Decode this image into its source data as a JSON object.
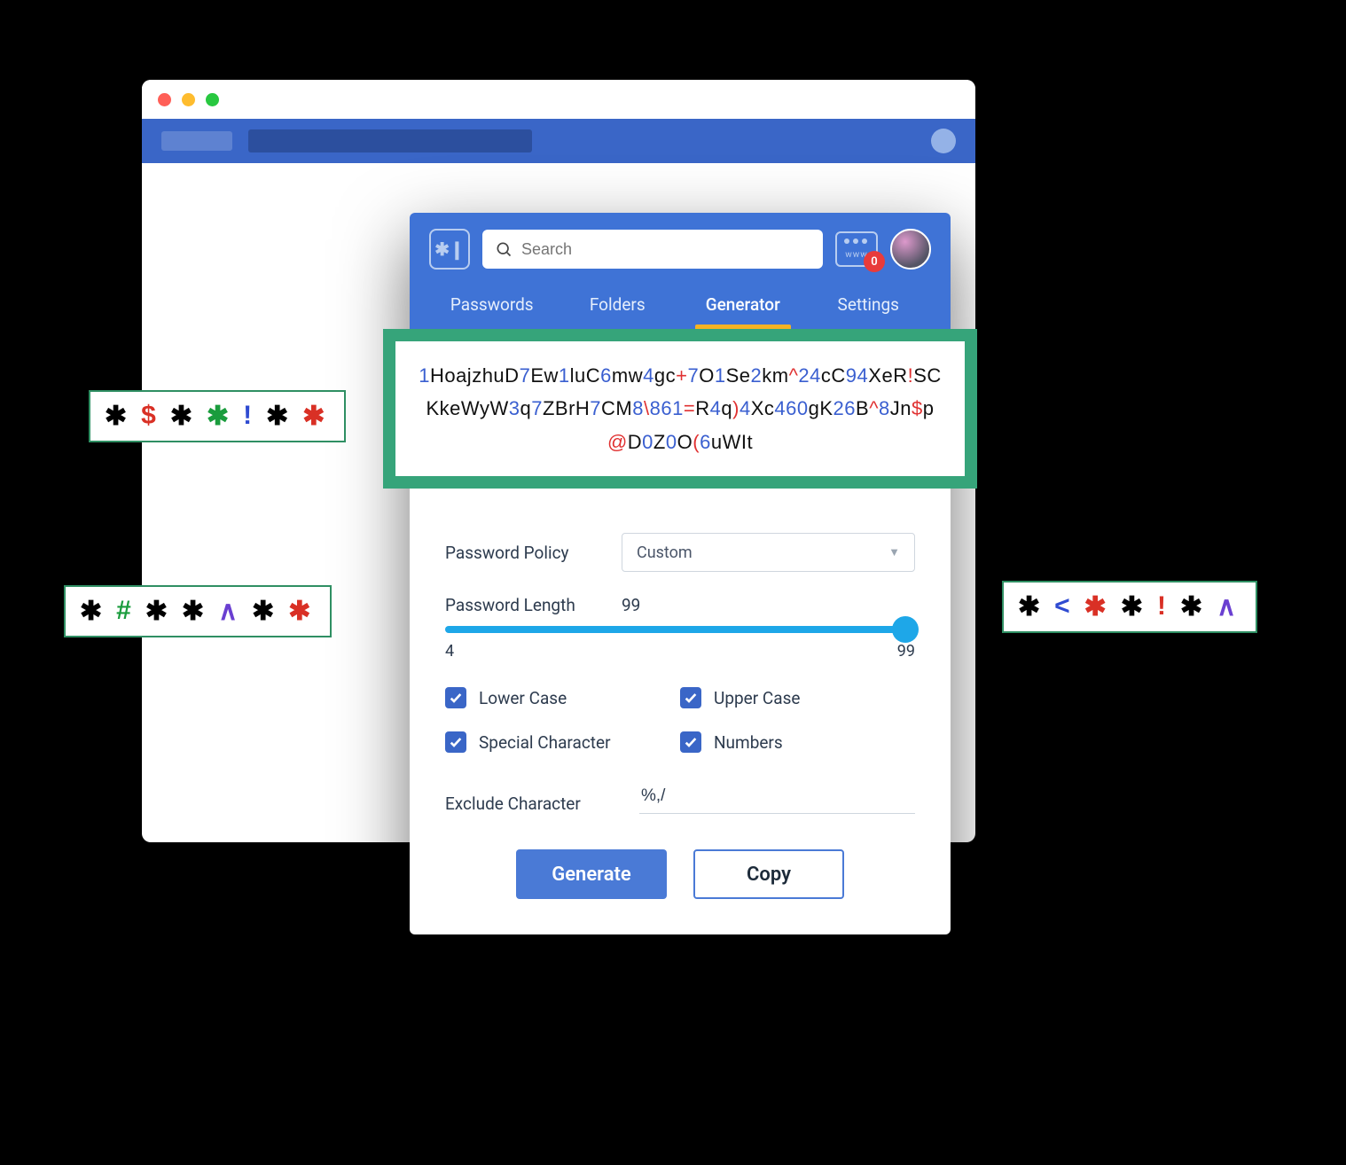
{
  "search": {
    "placeholder": "Search"
  },
  "www_count": "0",
  "tabs": {
    "passwords": "Passwords",
    "folders": "Folders",
    "generator": "Generator",
    "settings": "Settings"
  },
  "generated_password": {
    "tokens": [
      {
        "t": "1",
        "c": "n"
      },
      {
        "t": "HoajzhuD",
        "c": "a"
      },
      {
        "t": "7",
        "c": "n"
      },
      {
        "t": "Ew",
        "c": "a"
      },
      {
        "t": "1",
        "c": "n"
      },
      {
        "t": "luC",
        "c": "a"
      },
      {
        "t": "6",
        "c": "n"
      },
      {
        "t": "mw",
        "c": "a"
      },
      {
        "t": "4",
        "c": "n"
      },
      {
        "t": "gc",
        "c": "a"
      },
      {
        "t": "+",
        "c": "s"
      },
      {
        "t": "7",
        "c": "n"
      },
      {
        "t": "O",
        "c": "a"
      },
      {
        "t": "1",
        "c": "n"
      },
      {
        "t": "Se",
        "c": "a"
      },
      {
        "t": "2",
        "c": "n"
      },
      {
        "t": "km",
        "c": "a"
      },
      {
        "t": "^",
        "c": "s"
      },
      {
        "t": "24",
        "c": "n"
      },
      {
        "t": "cC",
        "c": "a"
      },
      {
        "t": "9",
        "c": "n"
      },
      {
        "t": "4",
        "c": "n"
      },
      {
        "t": "XeR",
        "c": "a"
      },
      {
        "t": "!",
        "c": "s"
      },
      {
        "t": "SCKkeWyW",
        "c": "a"
      },
      {
        "t": "3",
        "c": "n"
      },
      {
        "t": "q",
        "c": "a"
      },
      {
        "t": "7",
        "c": "n"
      },
      {
        "t": "ZBrH",
        "c": "a"
      },
      {
        "t": "7",
        "c": "n"
      },
      {
        "t": "CM",
        "c": "a"
      },
      {
        "t": "8",
        "c": "n"
      },
      {
        "t": "\\",
        "c": "s"
      },
      {
        "t": "861",
        "c": "n"
      },
      {
        "t": "=",
        "c": "s"
      },
      {
        "t": "R",
        "c": "a"
      },
      {
        "t": "4",
        "c": "n"
      },
      {
        "t": "q",
        "c": "a"
      },
      {
        "t": ")",
        "c": "s"
      },
      {
        "t": "4",
        "c": "n"
      },
      {
        "t": "Xc",
        "c": "a"
      },
      {
        "t": "46",
        "c": "n"
      },
      {
        "t": "0",
        "c": "n"
      },
      {
        "t": "gK",
        "c": "a"
      },
      {
        "t": "26",
        "c": "n"
      },
      {
        "t": "B",
        "c": "a"
      },
      {
        "t": "^",
        "c": "s"
      },
      {
        "t": "8",
        "c": "n"
      },
      {
        "t": "Jn",
        "c": "a"
      },
      {
        "t": "$",
        "c": "s"
      },
      {
        "t": "p",
        "c": "a"
      },
      {
        "t": "@",
        "c": "s"
      },
      {
        "t": "D",
        "c": "a"
      },
      {
        "t": "0",
        "c": "n"
      },
      {
        "t": "Z",
        "c": "a"
      },
      {
        "t": "0",
        "c": "n"
      },
      {
        "t": "O",
        "c": "a"
      },
      {
        "t": "(",
        "c": "s"
      },
      {
        "t": "6",
        "c": "n"
      },
      {
        "t": "uWIt",
        "c": "a"
      }
    ]
  },
  "form": {
    "policy_label": "Password Policy",
    "policy_value": "Custom",
    "length_label": "Password Length",
    "length_value": "99",
    "length_min": "4",
    "length_max": "99",
    "lower_label": "Lower Case",
    "upper_label": "Upper Case",
    "special_label": "Special Character",
    "numbers_label": "Numbers",
    "exclude_label": "Exclude Character",
    "exclude_value": "%,/"
  },
  "buttons": {
    "generate": "Generate",
    "copy": "Copy"
  },
  "decor": {
    "tag1": [
      {
        "t": "✱",
        "c": "k"
      },
      {
        "t": "$",
        "c": "r"
      },
      {
        "t": "✱",
        "c": "k"
      },
      {
        "t": "✱",
        "c": "g"
      },
      {
        "t": "!",
        "c": "b"
      },
      {
        "t": "✱",
        "c": "k"
      },
      {
        "t": "✱",
        "c": "r"
      }
    ],
    "tag2": [
      {
        "t": "✱",
        "c": "k"
      },
      {
        "t": "#",
        "c": "g"
      },
      {
        "t": "✱",
        "c": "k"
      },
      {
        "t": "✱",
        "c": "k"
      },
      {
        "t": "∧",
        "c": "p"
      },
      {
        "t": "✱",
        "c": "k"
      },
      {
        "t": "✱",
        "c": "r"
      }
    ],
    "tag3": [
      {
        "t": "✱",
        "c": "k"
      },
      {
        "t": "<",
        "c": "b"
      },
      {
        "t": "✱",
        "c": "r"
      },
      {
        "t": "✱",
        "c": "k"
      },
      {
        "t": "!",
        "c": "r"
      },
      {
        "t": "✱",
        "c": "k"
      },
      {
        "t": "∧",
        "c": "p"
      }
    ]
  }
}
